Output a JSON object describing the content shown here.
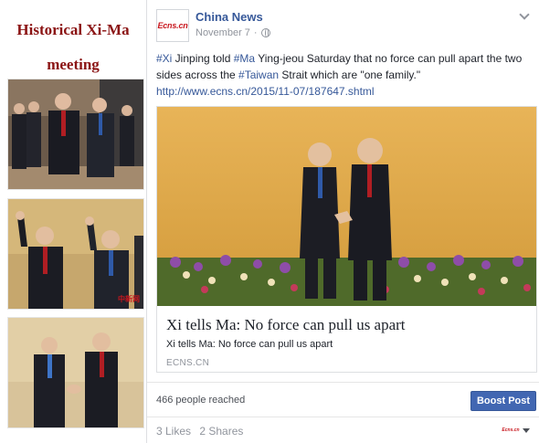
{
  "sidebar": {
    "title_line1": "Historical Xi-Ma",
    "title_line2": "meeting"
  },
  "post": {
    "page_name": "China News",
    "logo_text": "Ecns.cn",
    "date": "November 7",
    "separator": "·",
    "hashtag_xi": "#Xi",
    "text_part1": " Jinping told ",
    "hashtag_ma": "#Ma",
    "text_part2": " Ying-jeou Saturday that no force can pull apart the two sides across the ",
    "hashtag_taiwan": "#Taiwan",
    "text_part3": " Strait which are \"one family.\"",
    "url": "http://www.ecns.cn/2015/11-07/187647.shtml"
  },
  "link_card": {
    "title": "Xi tells Ma: No force can pull us apart",
    "description": "Xi tells Ma: No force can pull us apart",
    "domain": "ECNS.CN"
  },
  "insights": {
    "reached": "466 people reached",
    "boost_label": "Boost Post"
  },
  "engagement": {
    "likes": "3 Likes",
    "shares": "2 Shares"
  },
  "icons": {
    "privacy": "globe-icon",
    "menu": "chevron-down-icon",
    "viewer_menu": "caret-down-icon"
  },
  "colors": {
    "link": "#365899",
    "boost": "#4267b2",
    "sidebar_title": "#8b1414",
    "brand_red": "#c8161d"
  }
}
